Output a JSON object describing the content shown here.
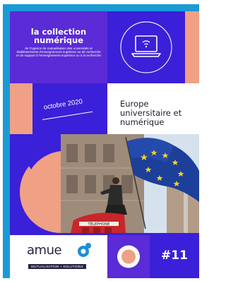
{
  "cover": {
    "series_title": "la collection numérique",
    "agency_text": "de l'Agence de mutualisation des universités et établissements d'enseignement supérieur ou de recherche et de support à l'enseignement supérieur ou à la recherche",
    "date": "octobre 2020",
    "report_title": "Europe universitaire et numérique",
    "publisher": "amue",
    "publisher_tagline": "MUTUALISATION + SOLUTIONS",
    "issue_number": "#11",
    "photo_sign_text": "TELEPHONE",
    "icons": [
      "laptop-wifi-icon",
      "circle-icon",
      "amue-logo-icon"
    ],
    "colors": {
      "border_blue": "#1a9ad6",
      "violet": "#5a2bd6",
      "indigo": "#3a20d8",
      "salmon": "#f0a085",
      "eu_blue": "#1c3f9a",
      "eu_star": "#f5d020",
      "phone_red": "#c8262a"
    }
  }
}
